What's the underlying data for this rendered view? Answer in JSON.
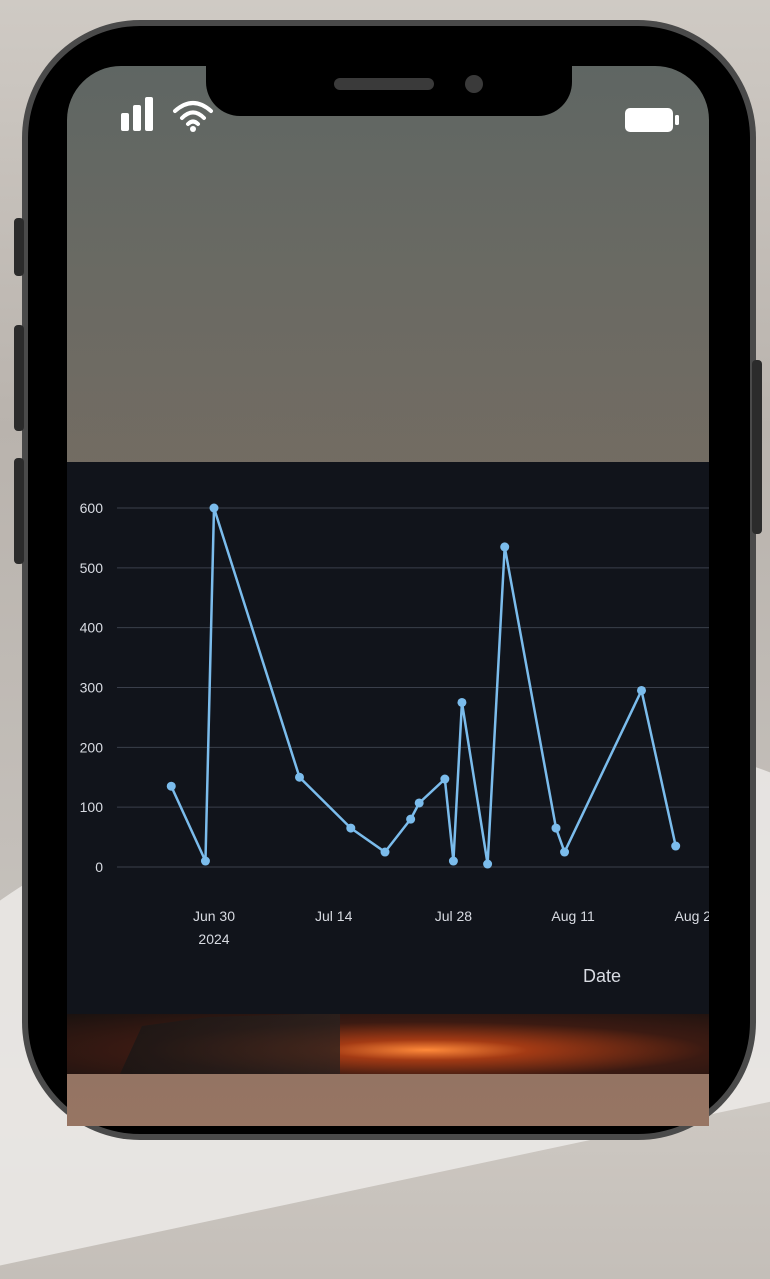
{
  "status_bar": {
    "signal_icon": "signal-bars-icon",
    "wifi_icon": "wifi-icon",
    "battery_icon": "battery-icon"
  },
  "colors": {
    "chart_background": "#11141b",
    "line": "#7bbcec",
    "grid": "#3a3f4b"
  },
  "chart_data": {
    "type": "line",
    "xlabel": "Date",
    "ylabel": "",
    "ylim": [
      0,
      600
    ],
    "y_ticks": [
      "0",
      "100",
      "200",
      "300",
      "400",
      "500",
      "600"
    ],
    "x_ticks": [
      {
        "date": "2024-06-30",
        "label": "Jun 30",
        "sublabel": "2024"
      },
      {
        "date": "2024-07-14",
        "label": "Jul 14",
        "sublabel": ""
      },
      {
        "date": "2024-07-28",
        "label": "Jul 28",
        "sublabel": ""
      },
      {
        "date": "2024-08-11",
        "label": "Aug 11",
        "sublabel": ""
      },
      {
        "date": "2024-08-25",
        "label": "Aug 2",
        "sublabel": ""
      }
    ],
    "grid": true,
    "series": [
      {
        "points": [
          {
            "x": "2024-06-25",
            "y": 135
          },
          {
            "x": "2024-06-29",
            "y": 10
          },
          {
            "x": "2024-06-30",
            "y": 600
          },
          {
            "x": "2024-07-10",
            "y": 150
          },
          {
            "x": "2024-07-16",
            "y": 65
          },
          {
            "x": "2024-07-20",
            "y": 25
          },
          {
            "x": "2024-07-23",
            "y": 80
          },
          {
            "x": "2024-07-24",
            "y": 107
          },
          {
            "x": "2024-07-27",
            "y": 147
          },
          {
            "x": "2024-07-28",
            "y": 10
          },
          {
            "x": "2024-07-29",
            "y": 275
          },
          {
            "x": "2024-08-01",
            "y": 5
          },
          {
            "x": "2024-08-03",
            "y": 535
          },
          {
            "x": "2024-08-09",
            "y": 65
          },
          {
            "x": "2024-08-10",
            "y": 25
          },
          {
            "x": "2024-08-19",
            "y": 295
          },
          {
            "x": "2024-08-23",
            "y": 35
          }
        ]
      }
    ]
  }
}
